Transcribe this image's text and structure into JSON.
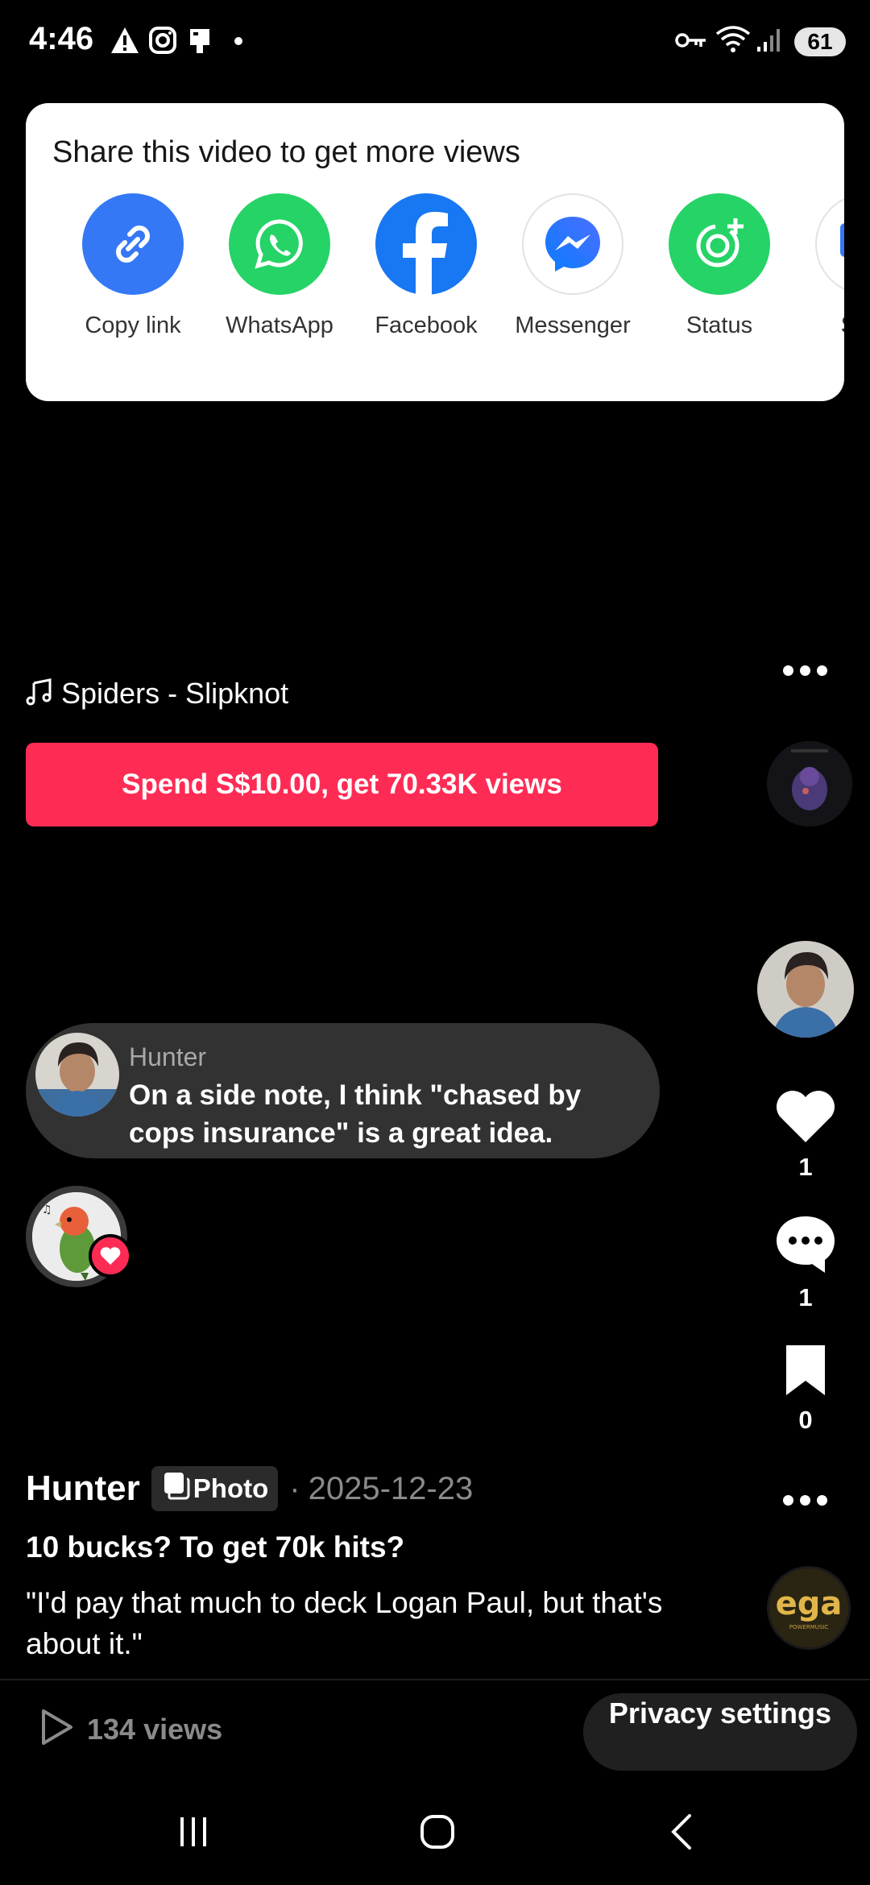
{
  "status_bar": {
    "time": "4:46",
    "battery": "61",
    "left_icons": [
      "warning-icon",
      "instagram-icon",
      "tiktok-icon",
      "dot-icon"
    ],
    "right_icons": [
      "vpn-key-icon",
      "wifi-icon",
      "signal-icon",
      "battery-icon"
    ]
  },
  "share": {
    "title": "Share this video to get more views",
    "items": [
      {
        "label": "Copy link",
        "icon": "link-icon",
        "color": "#3478f6"
      },
      {
        "label": "WhatsApp",
        "icon": "whatsapp-icon",
        "color": "#25d366"
      },
      {
        "label": "Facebook",
        "icon": "facebook-icon",
        "color": "#1877f2"
      },
      {
        "label": "Messenger",
        "icon": "messenger-icon",
        "color": "#ffffff"
      },
      {
        "label": "Status",
        "icon": "status-icon",
        "color": "#25d366"
      },
      {
        "label": "SMS",
        "icon": "sms-icon",
        "color": "#ffffff"
      }
    ]
  },
  "music": {
    "track": "Spiders - Slipknot"
  },
  "promote": {
    "label": "Spend S$10.00, get 70.33K views",
    "color": "#fe2c55"
  },
  "comment": {
    "user": "Hunter",
    "text": "On a side note, I think \"chased by cops insurance\" is a great idea."
  },
  "actions": {
    "likes": "1",
    "comments": "1",
    "saves": "0"
  },
  "post": {
    "author": "Hunter",
    "badge": "Photo",
    "date": "2025-12-23",
    "date_prefix": "·",
    "title": "10 bucks? To get 70k hits?",
    "description": "\"I'd pay that much to deck Logan Paul, but that's about it.\""
  },
  "footer": {
    "views": "134 views",
    "privacy_label": "Privacy settings"
  },
  "music_disc": {
    "label": "ega",
    "sublabel": "POWERMUSIC"
  }
}
